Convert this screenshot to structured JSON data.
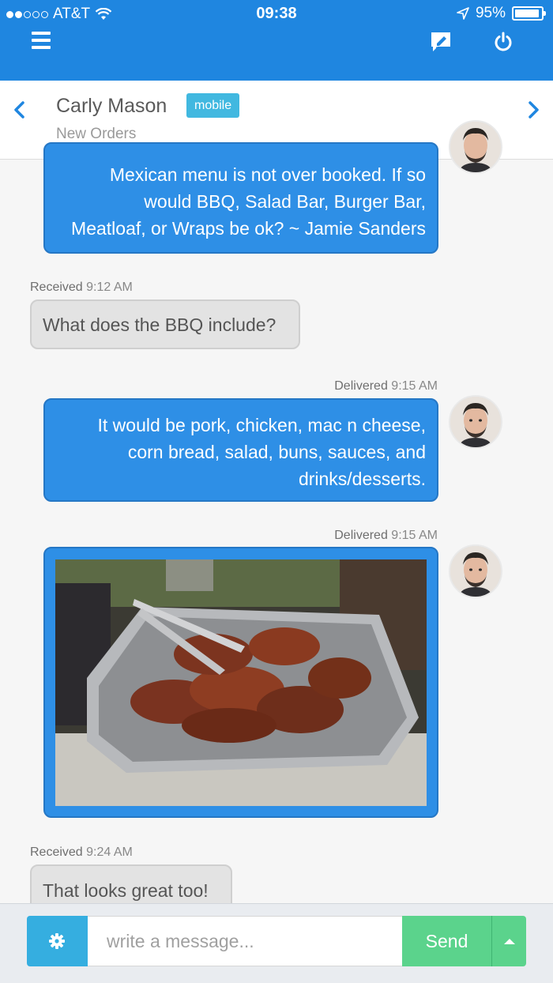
{
  "status_bar": {
    "carrier": "AT&T",
    "time": "09:38",
    "battery": "95%",
    "battery_level": 0.95
  },
  "contact": {
    "name": "Carly Mason",
    "badge": "mobile",
    "subtitle": "New Orders"
  },
  "messages": [
    {
      "direction": "out",
      "lines": [
        "Mexican menu is not over booked. If so",
        "would BBQ, Salad Bar, Burger Bar,",
        "Meatloaf, or Wraps be ok? ~ Jamie Sanders"
      ]
    },
    {
      "direction": "in",
      "status": "Received",
      "time": "9:12 AM",
      "text": "What does the BBQ include?"
    },
    {
      "direction": "out",
      "status": "Delivered",
      "time": "9:15 AM",
      "lines": [
        "It would be pork, chicken, mac n cheese,",
        "corn bread, salad, buns, sauces, and",
        "drinks/desserts."
      ]
    },
    {
      "direction": "out",
      "status": "Delivered",
      "time": "9:15 AM",
      "image": "bbq-chicken-tray"
    },
    {
      "direction": "in",
      "status": "Received",
      "time": "9:24 AM",
      "text": "That looks great too!"
    }
  ],
  "composer": {
    "placeholder": "write a message...",
    "send_label": "Send"
  },
  "colors": {
    "primary": "#1f86e0",
    "bubble_out": "#2e8fe6",
    "bubble_in": "#e3e3e3",
    "badge": "#41b8e0",
    "send": "#5bd38c",
    "settings": "#35aee0"
  },
  "icons": [
    "menu-icon",
    "compose-icon",
    "power-icon",
    "chevron-left-icon",
    "chevron-right-icon",
    "gear-icon",
    "caret-up-icon",
    "location-arrow-icon",
    "wifi-icon",
    "battery-icon"
  ]
}
